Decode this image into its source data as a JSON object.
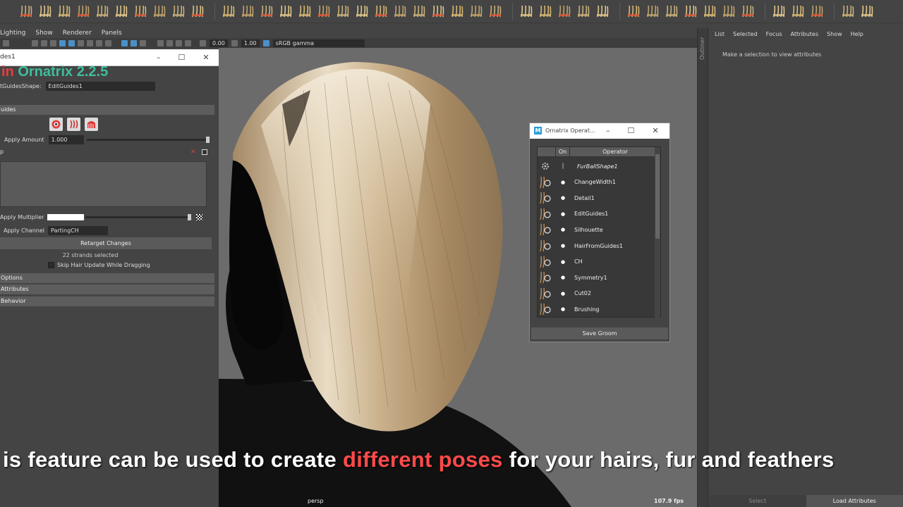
{
  "colors": {
    "accent_teal": "#3fbd9c",
    "accent_red": "#e83e3e",
    "subtitle_highlight": "#ff4a4a",
    "maya_blue": "#2a9bd8"
  },
  "viewport": {
    "menu": [
      "Lighting",
      "Show",
      "Renderer",
      "Panels"
    ],
    "exposure": "0.00",
    "gamma": "1.00",
    "color_space": "sRGB gamma",
    "camera": "persp",
    "fps": "107.9 fps"
  },
  "attribute_editor": {
    "window_title": "des1",
    "heading_red": "in",
    "heading_teal": "Ornatrix 2.2.5",
    "shape_label": "tGuidesShape:",
    "shape_value": "EditGuides1",
    "section_guides": "uides",
    "apply_amount_label": "Apply Amount",
    "apply_amount_value": "1.000",
    "p_label": "p",
    "apply_multiplier_label": "Apply Multiplier",
    "apply_channel_label": "Apply Channel",
    "apply_channel_value": "PartingCH",
    "retarget_button": "Retarget Changes",
    "strands_selected": "22 strands selected",
    "skip_update_label": "Skip Hair Update While Dragging",
    "sections": [
      "Options",
      "Attributes",
      "Behavior"
    ]
  },
  "ornatrix_operators": {
    "title": "Ornatrix Operat...",
    "header_on": "On",
    "header_operator": "Operator",
    "operators": [
      {
        "name": "FurBallShape1",
        "icon": "gear-icon",
        "italic": true
      },
      {
        "name": "ChangeWidth1",
        "icon": "change-width-icon"
      },
      {
        "name": "Detail1",
        "icon": "detail-icon"
      },
      {
        "name": "EditGuides1",
        "icon": "edit-guides-icon"
      },
      {
        "name": "Silhouette",
        "icon": "silhouette-icon"
      },
      {
        "name": "HairFromGuides1",
        "icon": "hair-from-guides-icon"
      },
      {
        "name": "CH",
        "icon": "channel-icon"
      },
      {
        "name": "Symmetry1",
        "icon": "symmetry-icon"
      },
      {
        "name": "Cut02",
        "icon": "cut-icon"
      },
      {
        "name": "Brushing",
        "icon": "brushing-icon"
      }
    ],
    "save_button": "Save Groom"
  },
  "channel_box": {
    "menu": [
      "List",
      "Selected",
      "Focus",
      "Attributes",
      "Show",
      "Help"
    ],
    "message": "Make a selection to view attributes",
    "outliner_tab": "Outliner",
    "bottom_buttons": [
      "Select",
      "Load Attributes"
    ]
  },
  "subtitle": {
    "before": "is feature can be used to create ",
    "highlight": "different poses",
    "after": " for your hairs, fur and feathers"
  }
}
